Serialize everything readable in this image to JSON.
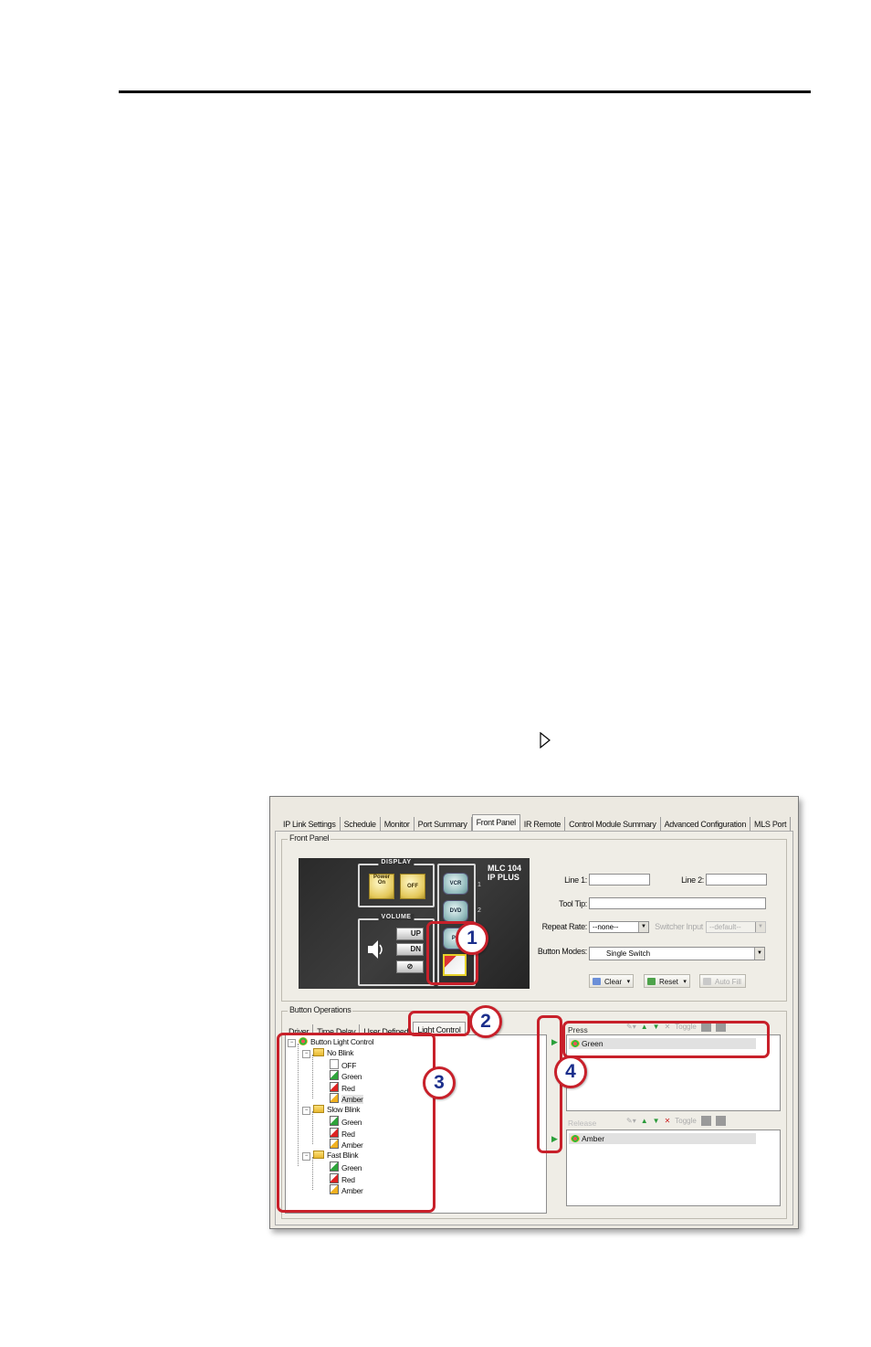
{
  "tabs": [
    "IP Link Settings",
    "Schedule",
    "Monitor",
    "Port Summary",
    "Front Panel",
    "IR Remote",
    "Control Module Summary",
    "Advanced Configuration",
    "MLS Port"
  ],
  "active_tab": "Front Panel",
  "front_panel": {
    "group_label": "Front Panel",
    "device": {
      "model_line1": "MLC 104",
      "model_line2": "IP PLUS",
      "display_label": "DISPLAY",
      "power_on": "Power On",
      "off": "OFF",
      "volume_label": "VOLUME",
      "up": "UP",
      "dn": "DN",
      "vcr": "VCR",
      "dvd": "DVD",
      "pc": "PC",
      "num1": "1",
      "num2": "2"
    },
    "line1_label": "Line 1:",
    "line1_value": "",
    "line2_label": "Line 2:",
    "line2_value": "",
    "tooltip_label": "Tool Tip:",
    "tooltip_value": "",
    "repeat_rate_label": "Repeat Rate:",
    "repeat_rate_value": "--none--",
    "switcher_input_label": "Switcher Input",
    "switcher_input_value": "--default--",
    "button_modes_label": "Button Modes:",
    "button_modes_value": "Single Switch",
    "clear_label": "Clear",
    "reset_label": "Reset",
    "autofill_label": "Auto Fill"
  },
  "button_operations": {
    "group_label": "Button Operations",
    "tabs": [
      "Driver",
      "Time Delay",
      "User Defined",
      "Light Control"
    ],
    "active_tab": "Light Control",
    "tree": {
      "root": "Button Light Control",
      "groups": [
        {
          "name": "No Blink",
          "items": [
            "OFF",
            "Green",
            "Red",
            "Amber"
          ]
        },
        {
          "name": "Slow Blink",
          "items": [
            "Green",
            "Red",
            "Amber"
          ]
        },
        {
          "name": "Fast Blink",
          "items": [
            "Green",
            "Red",
            "Amber"
          ]
        }
      ]
    },
    "press_label": "Press",
    "press_items": [
      "Green"
    ],
    "release_label": "Release",
    "release_items": [
      "Amber"
    ],
    "toggle_label": "Toggle"
  },
  "callouts": [
    "1",
    "2",
    "3",
    "4"
  ],
  "colors": {
    "callout": "#c8202a",
    "badge_text": "#1c2f8c"
  }
}
